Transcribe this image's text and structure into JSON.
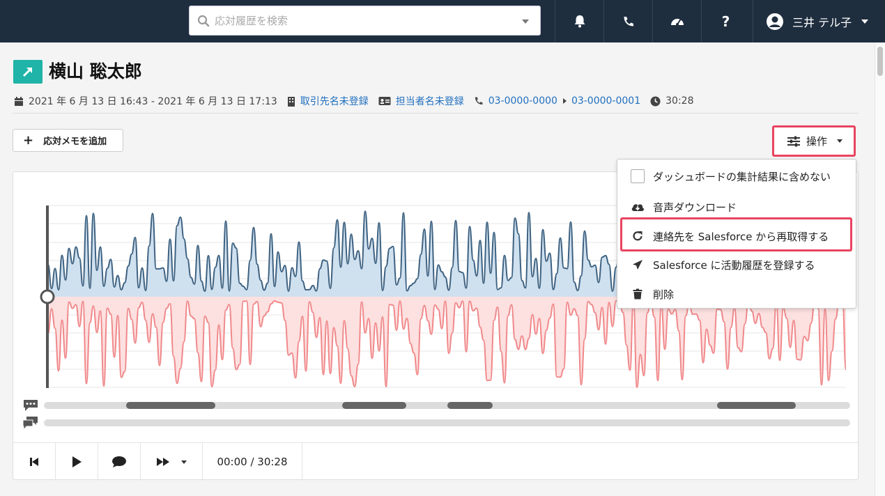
{
  "search": {
    "placeholder": "応対履歴を検索"
  },
  "user": {
    "name": "三井 テル子"
  },
  "record": {
    "title": "横山 聡太郎",
    "datetime": "2021 年 6 月 13 日 16:43 - 2021 年 6 月 13 日 17:13",
    "company": "取引先名未登録",
    "contact": "担当者名未登録",
    "from_phone": "03-0000-0000",
    "to_phone": "03-0000-0001",
    "duration": "30:28"
  },
  "actions": {
    "add_memo": "応対メモを追加",
    "operations": "操作"
  },
  "menu": {
    "exclude_dashboard": "ダッシュボードの集計結果に含めない",
    "download_audio": "音声ダウンロード",
    "refetch_salesforce": "連絡先を Salesforce から再取得する",
    "register_salesforce": "Salesforce に活動履歴を登録する",
    "delete": "削除"
  },
  "player": {
    "time": "00:00 / 30:28",
    "progress": 0
  },
  "colors": {
    "topbar": "#1f2e3f",
    "accent": "#1fb4a7",
    "link": "#1f6fbf",
    "highlight": "#e8445f",
    "wave_upper_line": "#3d6180",
    "wave_upper_fill": "#cfe0ef",
    "wave_lower_line": "#f0888a",
    "wave_lower_fill": "#fde0e0"
  }
}
